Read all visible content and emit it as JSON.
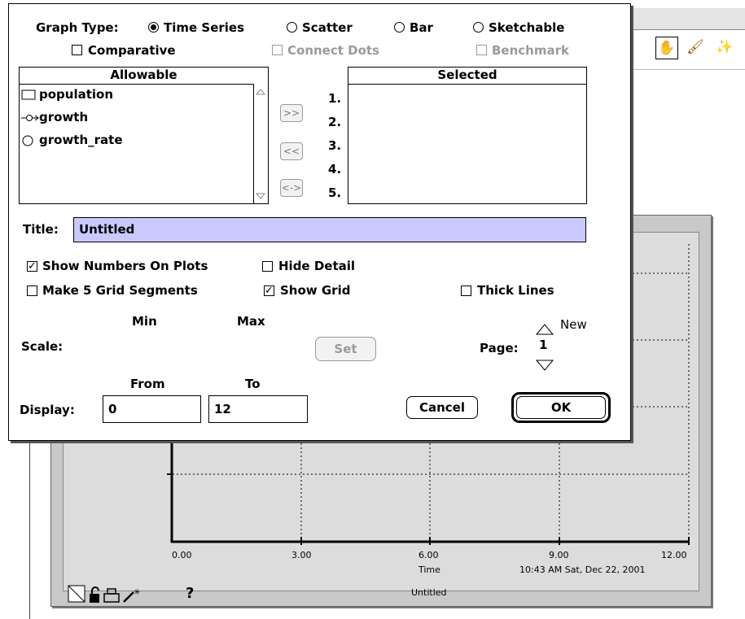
{
  "dialog": {
    "graph_type_label": "Graph Type:",
    "graph_types": [
      "Time Series",
      "Scatter",
      "Bar",
      "Sketchable"
    ],
    "selected_graph_type": "Time Series",
    "comparative_label": "Comparative",
    "connect_dots_label": "Connect Dots",
    "benchmark_label": "Benchmark",
    "allowable_header": "Allowable",
    "selected_header": "Selected",
    "allowable_items": [
      {
        "label": "population",
        "icon": "stock-icon"
      },
      {
        "label": "growth",
        "icon": "flow-icon"
      },
      {
        "label": "growth_rate",
        "icon": "converter-icon"
      }
    ],
    "move_buttons": [
      ">>",
      "<<",
      "<->"
    ],
    "slot_numbers": [
      "1.",
      "2.",
      "3.",
      "4.",
      "5."
    ],
    "title_label": "Title:",
    "title_value": "Untitled",
    "show_numbers_label": "Show Numbers On Plots",
    "hide_detail_label": "Hide Detail",
    "grid_segments_label": "Make 5 Grid Segments",
    "show_grid_label": "Show Grid",
    "thick_lines_label": "Thick Lines",
    "min_label": "Min",
    "max_label": "Max",
    "scale_label": "Scale:",
    "set_button": "Set",
    "page_label": "Page:",
    "page_value": "1",
    "new_label": "New",
    "from_label": "From",
    "to_label": "To",
    "display_label": "Display:",
    "display_from": "0",
    "display_to": "12",
    "cancel_button": "Cancel",
    "ok_button": "OK",
    "checks": {
      "comparative": false,
      "show_numbers": true,
      "hide_detail": false,
      "grid_segments": false,
      "show_grid": true,
      "thick_lines": false
    }
  },
  "graph": {
    "x_ticks": [
      "0.00",
      "3.00",
      "6.00",
      "9.00",
      "12.00"
    ],
    "x_axis_label": "Time",
    "timestamp": "10:43 AM  Sat, Dec 22, 2001",
    "title": "Untitled",
    "help_glyph": "?"
  },
  "toolbar_icons": [
    "hand-icon",
    "paint-brush-icon",
    "magic-wand-icon"
  ],
  "colors": {
    "title_highlight": "#c9c9ff",
    "panel_gray": "#c9c9c9",
    "dim_text": "#9a9a9a"
  }
}
